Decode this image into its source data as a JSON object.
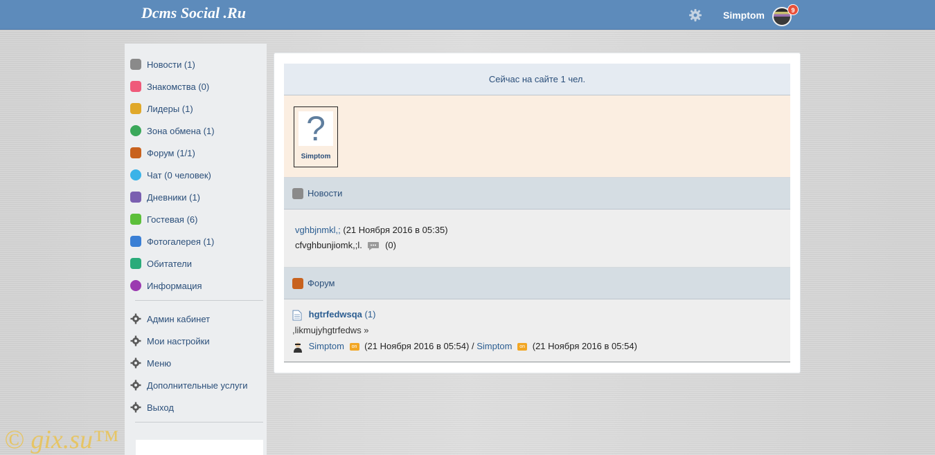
{
  "header": {
    "logo": "Dcms Social .Ru",
    "username": "Simptom",
    "notifications": "9",
    "settings_icon": "gear-icon"
  },
  "sidebar": {
    "items": [
      {
        "label": "Новости (1)",
        "icon": "news-icon",
        "color": "#8a8a8a"
      },
      {
        "label": "Знакомства (0)",
        "icon": "heart-icon",
        "color": "#ef5a7a"
      },
      {
        "label": "Лидеры (1)",
        "icon": "trophy-icon",
        "color": "#e0a82a"
      },
      {
        "label": "Зона обмена (1)",
        "icon": "exchange-icon",
        "color": "#3aa85a"
      },
      {
        "label": "Форум (1/1)",
        "icon": "pencil-icon",
        "color": "#c8621e"
      },
      {
        "label": "Чат (0 человек)",
        "icon": "chat-icon",
        "color": "#3ab3e8"
      },
      {
        "label": "Дневники (1)",
        "icon": "diary-icon",
        "color": "#7a5fb0"
      },
      {
        "label": "Гостевая (6)",
        "icon": "guestbook-icon",
        "color": "#5cbf3a"
      },
      {
        "label": "Фотогалерея (1)",
        "icon": "camera-icon",
        "color": "#3a7fd5"
      },
      {
        "label": "Обитатели",
        "icon": "users-icon",
        "color": "#2aab7a"
      },
      {
        "label": "Информация",
        "icon": "help-icon",
        "color": "#9b3ab0"
      }
    ],
    "settings": [
      {
        "label": "Админ кабинет",
        "icon": "gear-icon"
      },
      {
        "label": "Мои настройки",
        "icon": "gear-icon"
      },
      {
        "label": "Меню",
        "icon": "gear-icon"
      },
      {
        "label": "Дополнительные услуги",
        "icon": "gear-icon"
      },
      {
        "label": "Выход",
        "icon": "gear-icon"
      }
    ]
  },
  "main": {
    "online_title": "Сейчас на сайте 1 чел.",
    "online_user": {
      "name": "Simptom",
      "avatar": "?"
    },
    "news": {
      "title": "Новости",
      "item_link": "vghbjnmkl,;",
      "item_date": "(21 Ноября 2016 в 05:35)",
      "item_text": "cfvghbunjiomk,;l.",
      "item_comments": "(0)"
    },
    "forum": {
      "title": "Форум",
      "topic_title": "hgtrfedwsqa",
      "topic_count": "(1)",
      "topic_text": ",likmujyhgtrfedws »",
      "author": "Simptom",
      "created": "(21 Ноября 2016 в 05:54)",
      "separator": "/",
      "last_author": "Simptom",
      "last_date": "(21 Ноября 2016 в 05:54)",
      "online_badge": "on"
    }
  },
  "watermark": "© gix.su™"
}
